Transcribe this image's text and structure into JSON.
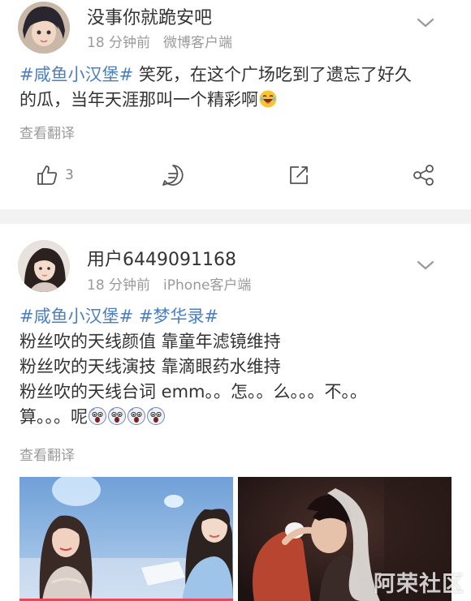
{
  "posts": [
    {
      "username": "没事你就跪安吧",
      "time": "18 分钟前",
      "source": "微博客户端",
      "lines": [
        {
          "tags": [
            "#咸鱼小汉堡#"
          ],
          "text": " 笑死，在这个广场吃到了遗忘了好久"
        },
        {
          "tags": [],
          "text": "的瓜，当年天涯那叫一个精彩啊"
        }
      ],
      "translate": "查看翻译",
      "like_count": "3",
      "emoji": "laughing-crying-emoji"
    },
    {
      "username": "用户6449091168",
      "time": "18 分钟前",
      "source": "iPhone客户端",
      "tags": [
        "#咸鱼小汉堡#",
        "#梦华录#"
      ],
      "lines": [
        "粉丝吹的天线颜值 靠童年滤镜维持",
        "粉丝吹的天线演技 靠滴眼药水维持",
        "粉丝吹的天线台词 emm。。怎。。么。。。不。。",
        "算。。。呢"
      ],
      "emoji": "shocked-face-emoji",
      "emoji_count": 4,
      "translate": "查看翻译"
    }
  ],
  "watermark": "阿荣社区",
  "colors": {
    "tag": "#4a7fc1",
    "meta": "#9a9a9a",
    "divider": "#f2f2f2"
  }
}
